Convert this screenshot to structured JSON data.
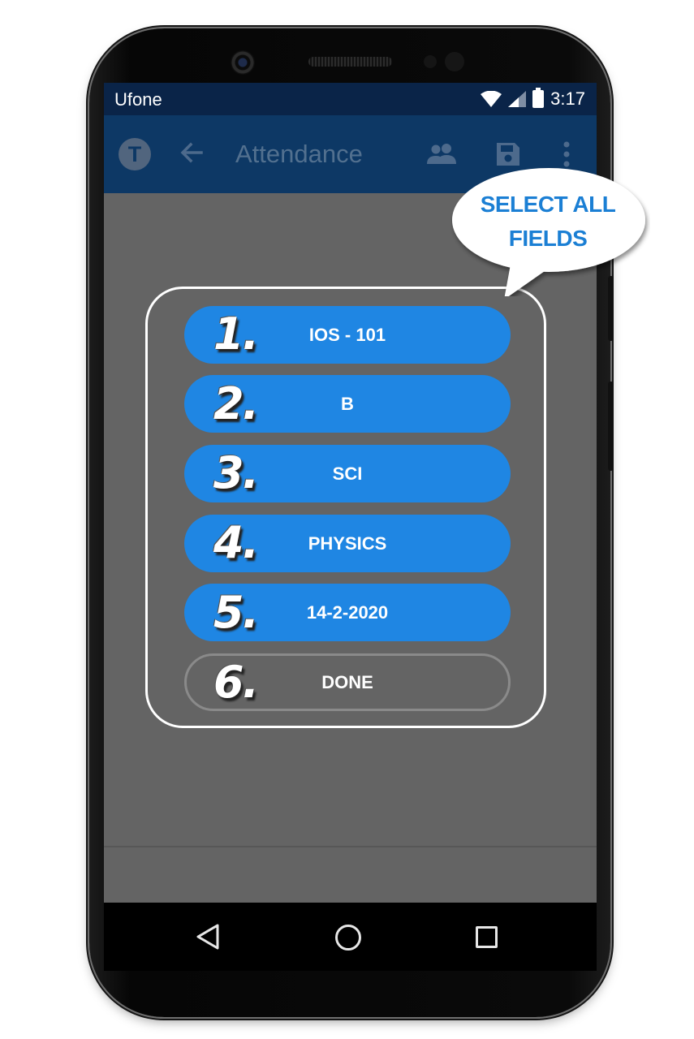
{
  "status_bar": {
    "carrier": "Ufone",
    "time": "3:17"
  },
  "app_bar": {
    "avatar_letter": "T",
    "title": "Attendance",
    "icons": [
      "back-arrow-icon",
      "group-icon",
      "save-icon",
      "more-vert-icon"
    ]
  },
  "callout": {
    "line1": "SELECT ALL",
    "line2": "FIELDS"
  },
  "steps": [
    {
      "number": "1.",
      "label": "IOS - 101"
    },
    {
      "number": "2.",
      "label": "B"
    },
    {
      "number": "3.",
      "label": "SCI"
    },
    {
      "number": "4.",
      "label": "PHYSICS"
    },
    {
      "number": "5.",
      "label": "14-2-2020"
    },
    {
      "number": "6.",
      "label": "DONE"
    }
  ],
  "nav_bar": {
    "icons": [
      "nav-back-icon",
      "nav-home-icon",
      "nav-recent-apps-icon"
    ]
  },
  "colors": {
    "status_bar": "#0a2448",
    "app_bar": "#0d3865",
    "button": "#1f86e3",
    "callout_text": "#1b7fd4",
    "screen_overlay": "#646464"
  }
}
